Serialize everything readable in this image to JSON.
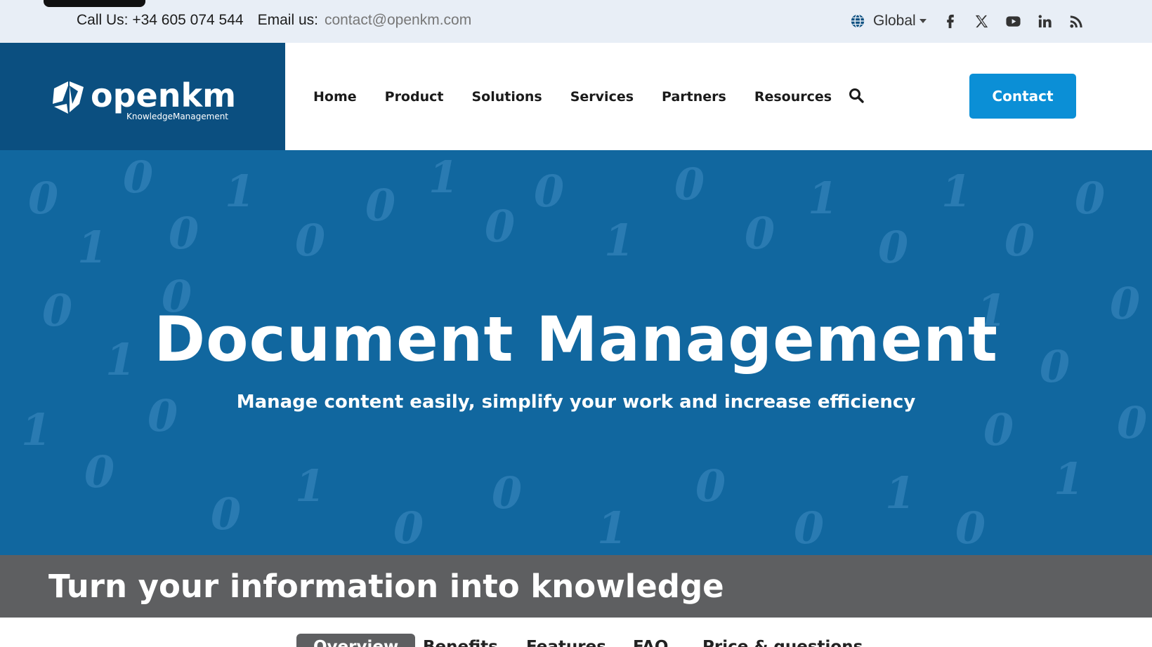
{
  "topbar": {
    "call_label": "Call Us: +34 605 074 544",
    "email_label": "Email us:",
    "email_value": "contact@openkm.com",
    "region_label": "Global",
    "social_icons": [
      "facebook-icon",
      "x-twitter-icon",
      "youtube-icon",
      "linkedin-icon",
      "rss-icon"
    ]
  },
  "logo": {
    "name": "openkm",
    "tagline": "KnowledgeManagement"
  },
  "nav": {
    "items": [
      "Home",
      "Product",
      "Solutions",
      "Services",
      "Partners",
      "Resources"
    ],
    "contact_label": "Contact"
  },
  "hero": {
    "title": "Document Management",
    "subtitle": "Manage content easily, simplify your work and increase efficiency"
  },
  "band": {
    "title": "Turn your information into knowledge"
  },
  "subtabs": {
    "items": [
      "Overview",
      "Benefits",
      "Features",
      "FAQ",
      "Price & questions"
    ],
    "active": "Overview"
  },
  "colors": {
    "topbar_bg": "#e8eef6",
    "logo_bg": "#0b4f80",
    "accent": "#0b8fd6",
    "hero_bg": "#11679f",
    "band_bg": "#5e5f61"
  }
}
